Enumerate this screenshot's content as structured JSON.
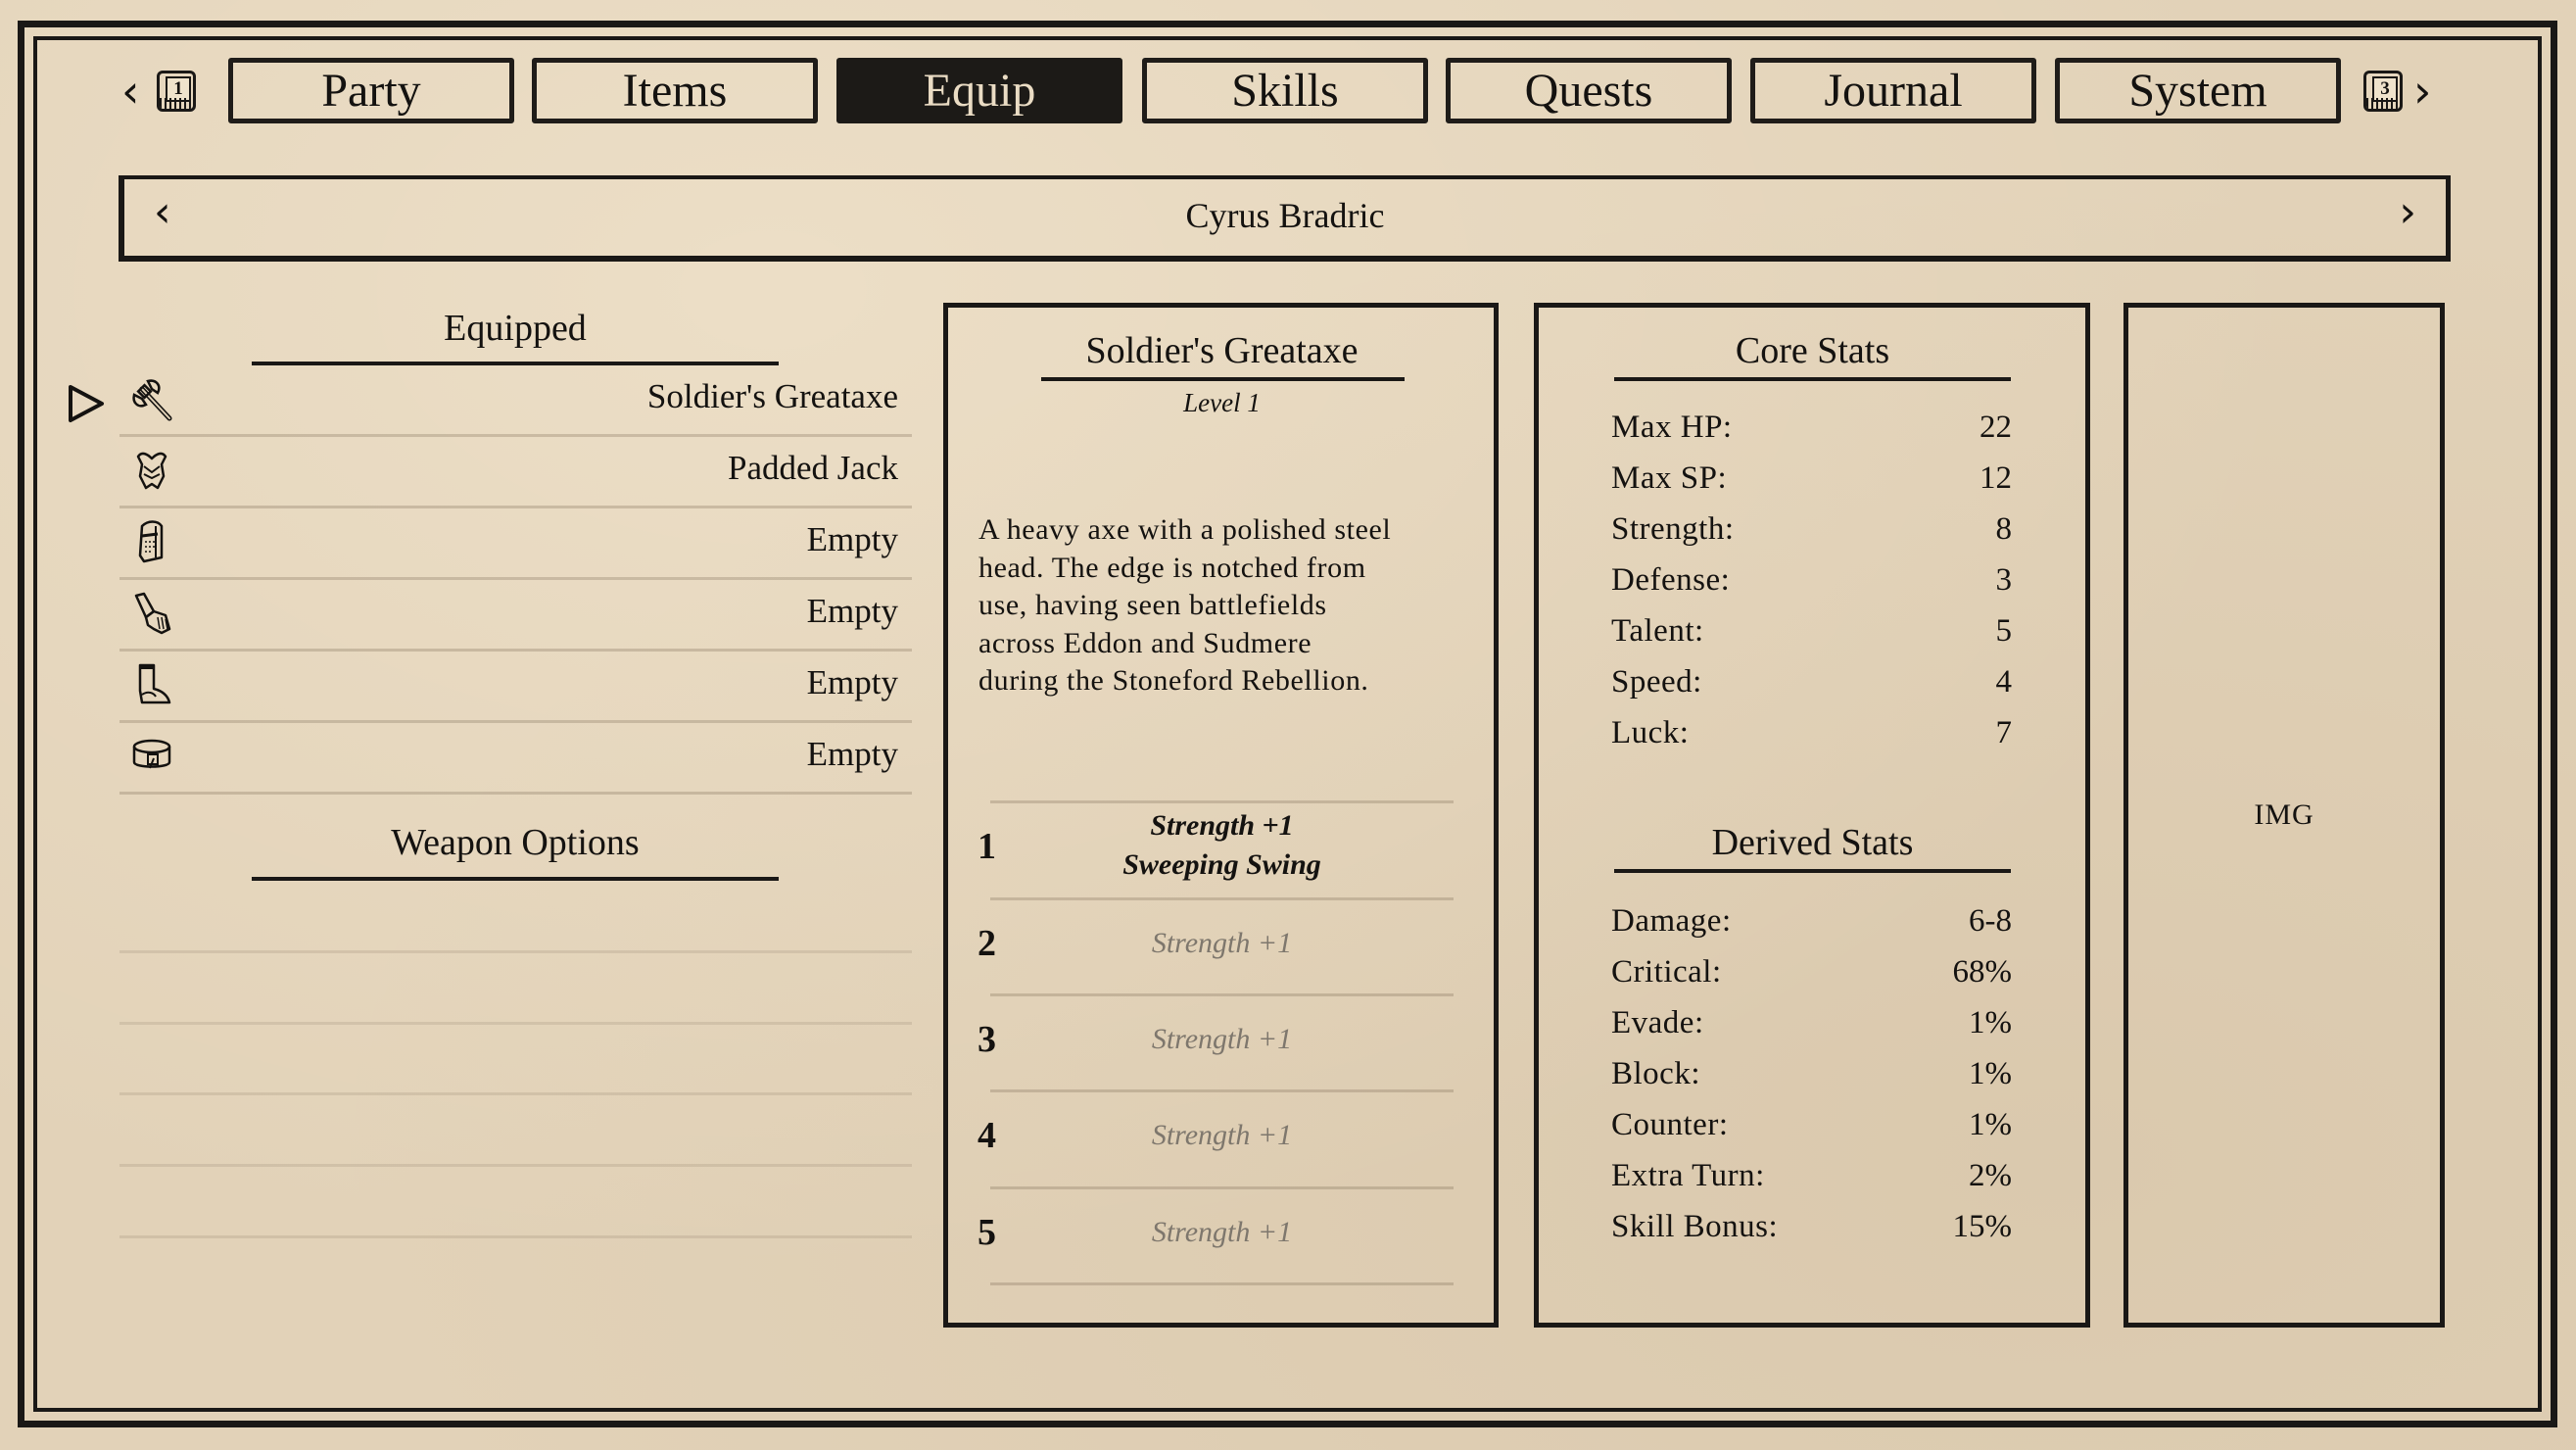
{
  "nav": {
    "prev_key": "1",
    "next_key": "3",
    "prev_chevron": "‹",
    "next_chevron": "›",
    "tabs": [
      {
        "label": "Party",
        "active": false
      },
      {
        "label": "Items",
        "active": false
      },
      {
        "label": "Equip",
        "active": true
      },
      {
        "label": "Skills",
        "active": false
      },
      {
        "label": "Quests",
        "active": false
      },
      {
        "label": "Journal",
        "active": false
      },
      {
        "label": "System",
        "active": false
      }
    ]
  },
  "character": {
    "name": "Cyrus Bradric",
    "prev_chevron": "‹",
    "next_chevron": "›"
  },
  "equipped": {
    "heading": "Equipped",
    "selected_index": 0,
    "slots": [
      {
        "icon": "axe-icon",
        "label": "Soldier's Greataxe"
      },
      {
        "icon": "chest-armor-icon",
        "label": "Padded Jack"
      },
      {
        "icon": "helmet-icon",
        "label": "Empty"
      },
      {
        "icon": "gauntlet-icon",
        "label": "Empty"
      },
      {
        "icon": "boot-icon",
        "label": "Empty"
      },
      {
        "icon": "belt-icon",
        "label": "Empty"
      }
    ]
  },
  "weapon_options": {
    "heading": "Weapon Options",
    "items": []
  },
  "item_detail": {
    "name": "Soldier's Greataxe",
    "level": "Level 1",
    "description": "A heavy axe with a polished steel head. The edge is notched from use, having seen battlefields across Eddon and Sudmere during the Stoneford Rebellion.",
    "description_lines": [
      "A heavy axe with a polished steel",
      "head. The edge is notched from",
      "use, having seen battlefields",
      "across Eddon and Sudmere",
      "during the Stoneford Rebellion."
    ],
    "levels": [
      {
        "num": "1",
        "bonus": "Strength +1",
        "skill": "Sweeping Swing",
        "unlocked": true
      },
      {
        "num": "2",
        "bonus": "Strength +1",
        "skill": "",
        "unlocked": false
      },
      {
        "num": "3",
        "bonus": "Strength +1",
        "skill": "",
        "unlocked": false
      },
      {
        "num": "4",
        "bonus": "Strength +1",
        "skill": "",
        "unlocked": false
      },
      {
        "num": "5",
        "bonus": "Strength +1",
        "skill": "",
        "unlocked": false
      }
    ]
  },
  "core_stats": {
    "heading": "Core Stats",
    "rows": [
      {
        "label": "Max HP:",
        "value": "22"
      },
      {
        "label": "Max SP:",
        "value": "12"
      },
      {
        "label": "Strength:",
        "value": "8"
      },
      {
        "label": "Defense:",
        "value": "3"
      },
      {
        "label": "Talent:",
        "value": "5"
      },
      {
        "label": "Speed:",
        "value": "4"
      },
      {
        "label": "Luck:",
        "value": "7"
      }
    ]
  },
  "derived_stats": {
    "heading": "Derived Stats",
    "rows": [
      {
        "label": "Damage:",
        "value": "6-8"
      },
      {
        "label": "Critical:",
        "value": "68%"
      },
      {
        "label": "Evade:",
        "value": "1%"
      },
      {
        "label": "Block:",
        "value": "1%"
      },
      {
        "label": "Counter:",
        "value": "1%"
      },
      {
        "label": "Extra Turn:",
        "value": "2%"
      },
      {
        "label": "Skill Bonus:",
        "value": "15%"
      }
    ]
  },
  "portrait": {
    "placeholder": "IMG"
  },
  "colors": {
    "paper": "#e2d2b8",
    "ink": "#141210",
    "active_tab_bg": "#1c1a17",
    "active_tab_text": "#eadcc4",
    "locked_text": "#7e776d"
  }
}
